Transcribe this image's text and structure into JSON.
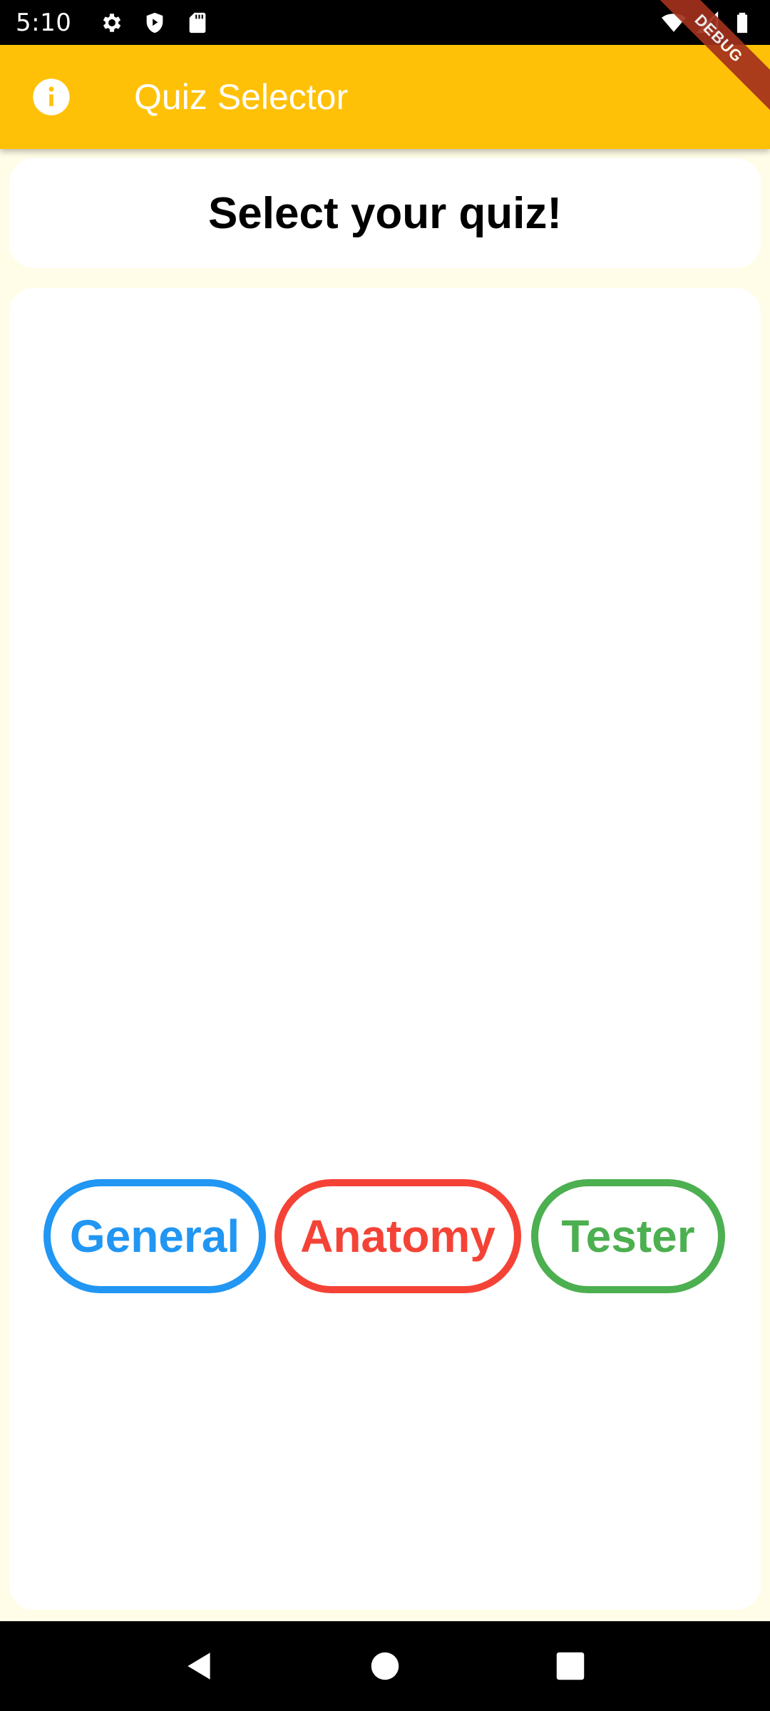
{
  "status_bar": {
    "time": "5:10",
    "left_icons": [
      "gear-icon",
      "shield-play-icon",
      "sd-card-icon"
    ],
    "right_icons": [
      "wifi-icon",
      "signal-icon",
      "battery-icon"
    ]
  },
  "debug_banner": {
    "label": "DEBUG",
    "color": "#A3311E"
  },
  "app_bar": {
    "title": "Quiz Selector",
    "leading_icon": "info-icon",
    "background": "#FFC107"
  },
  "header": {
    "title": "Select your quiz!"
  },
  "quizzes": [
    {
      "label": "General",
      "color": "#2196F3"
    },
    {
      "label": "Anatomy",
      "color": "#F44336"
    },
    {
      "label": "Tester",
      "color": "#4CAF50"
    }
  ],
  "nav_bar": {
    "buttons": [
      "back-icon",
      "home-icon",
      "recents-icon"
    ]
  },
  "colors": {
    "page_background": "#FFFDE7",
    "card_background": "#FFFFFF"
  }
}
